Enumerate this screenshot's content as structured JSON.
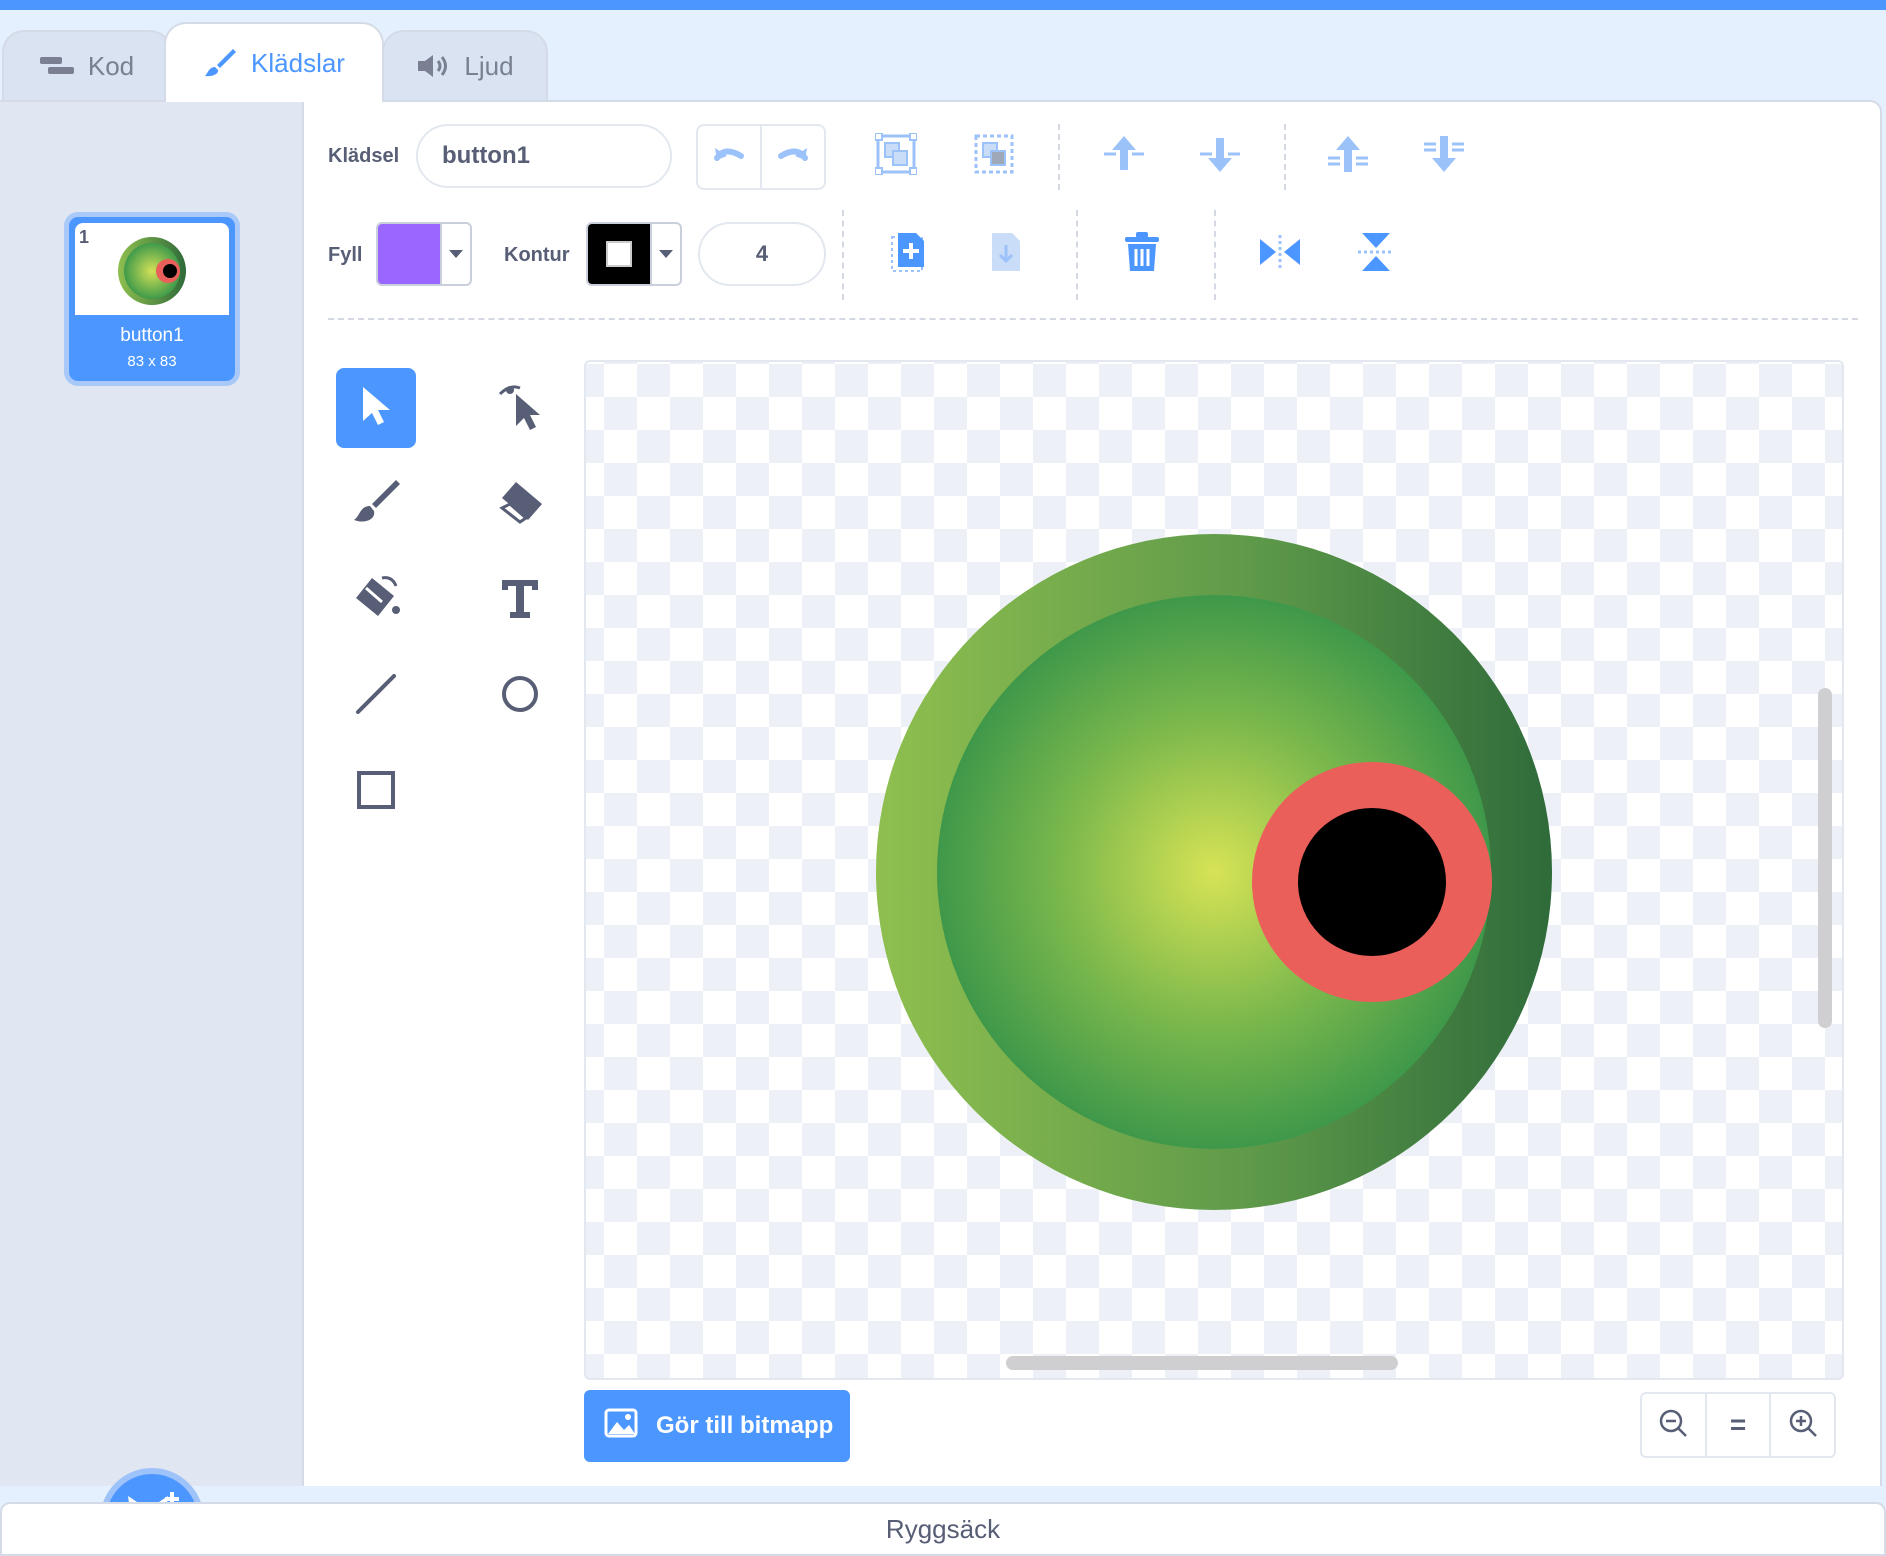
{
  "tabs": [
    {
      "label": "Kod",
      "icon": "code-icon",
      "active": false
    },
    {
      "label": "Klädslar",
      "icon": "brush-icon",
      "active": true
    },
    {
      "label": "Ljud",
      "icon": "speaker-icon",
      "active": false
    }
  ],
  "costumes": [
    {
      "number": "1",
      "name": "button1",
      "size": "83 x 83",
      "selected": true
    }
  ],
  "toolbar": {
    "costume_label": "Klädsel",
    "costume_name": "button1",
    "fill_label": "Fyll",
    "fill_color": "#9966ff",
    "outline_label": "Kontur",
    "outline_color": "#000000",
    "outline_width": "4"
  },
  "tools": [
    {
      "name": "select-tool",
      "icon": "arrow-icon",
      "selected": true
    },
    {
      "name": "reshape-tool",
      "icon": "reshape-icon",
      "selected": false
    },
    {
      "name": "brush-tool",
      "icon": "brush-icon",
      "selected": false
    },
    {
      "name": "eraser-tool",
      "icon": "eraser-icon",
      "selected": false
    },
    {
      "name": "fill-tool",
      "icon": "bucket-icon",
      "selected": false
    },
    {
      "name": "text-tool",
      "icon": "text-icon",
      "selected": false
    },
    {
      "name": "line-tool",
      "icon": "line-icon",
      "selected": false
    },
    {
      "name": "circle-tool",
      "icon": "circle-icon",
      "selected": false
    },
    {
      "name": "rectangle-tool",
      "icon": "rectangle-icon",
      "selected": false
    }
  ],
  "bitmap_button": "Gör till bitmapp",
  "zoom": {
    "out": "zoom-out-icon",
    "reset": "=",
    "in": "zoom-in-icon"
  },
  "backpack_label": "Ryggsäck",
  "colors": {
    "accent": "#4c97ff",
    "panel": "#e0e7f2",
    "text": "#575e75"
  }
}
